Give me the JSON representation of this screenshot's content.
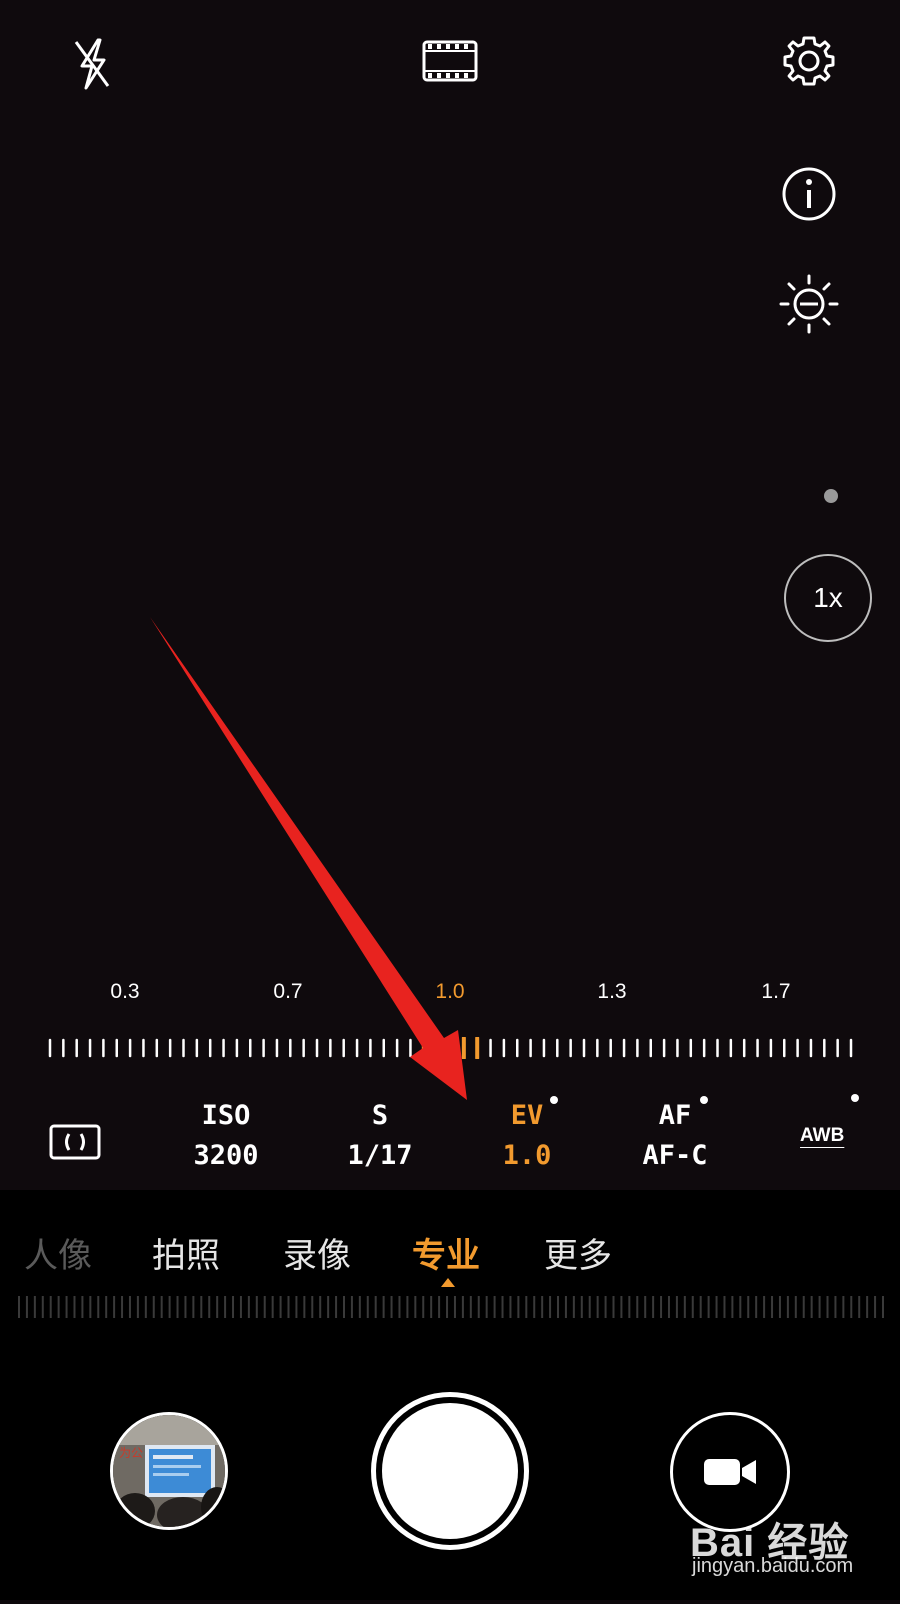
{
  "ev_scale": {
    "labels": [
      "0.3",
      "0.7",
      "1.0",
      "1.3",
      "1.7"
    ],
    "active_index": 2
  },
  "zoom": {
    "label": "1x"
  },
  "params": {
    "iso": {
      "name": "ISO",
      "value": "3200"
    },
    "shutter": {
      "name": "S",
      "value": "1/17"
    },
    "ev": {
      "name": "EV",
      "value": "1.0"
    },
    "af": {
      "name": "AF",
      "value": "AF-C"
    },
    "awb": {
      "name": "AWB"
    }
  },
  "modes": [
    {
      "label": "人像"
    },
    {
      "label": "拍照"
    },
    {
      "label": "录像"
    },
    {
      "label": "专业"
    },
    {
      "label": "更多"
    }
  ],
  "active_mode": "专业",
  "watermark": {
    "main": "Bai 经验",
    "sub": "jingyan.baidu.com"
  },
  "colors": {
    "accent": "#f29a2e",
    "annotation_arrow": "#e8231f"
  },
  "icons": {
    "flash": "flash-off-icon",
    "video_mode": "film-icon",
    "settings": "gear-icon",
    "info": "info-icon",
    "exposure": "sun-icon",
    "metering": "metering-icon",
    "record": "video-camera-icon"
  }
}
